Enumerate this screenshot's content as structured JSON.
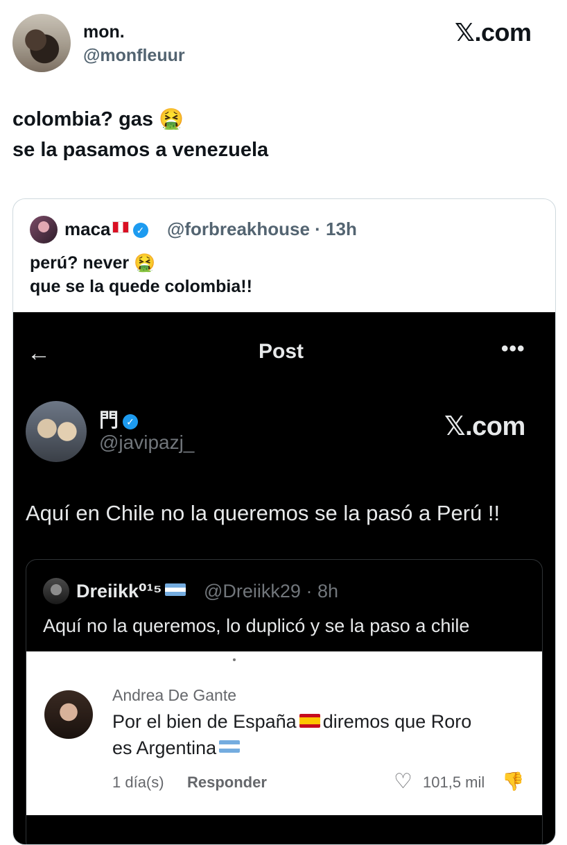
{
  "tweet": {
    "author_name": "mon.",
    "author_handle": "@monfleuur",
    "brand": "𝕏.com",
    "text_line1": "colombia? gas 🤮",
    "text_line2": "se la pasamos a venezuela"
  },
  "quote": {
    "author_name": "maca",
    "author_handle_time": "@forbreakhouse · 13h",
    "text_line1": "perú? never 🤮",
    "text_line2": "que se la quede colombia!!"
  },
  "embedded_post": {
    "header_title": "Post",
    "back_icon": "←",
    "more_icon": "•••",
    "author_name": "門",
    "author_handle": "@javipazj_",
    "brand": "𝕏.com",
    "text": "Aquí en Chile no la queremos se la pasó a Perú !!",
    "inner_quote": {
      "author_name": "Dreiikk⁰¹⁵",
      "author_handle_time": "@Dreiikk29 · 8h",
      "text": "Aquí no la queremos, lo duplicó y se la paso a chile"
    },
    "comment": {
      "author_name": "Andrea De Gante",
      "text_line1_a": "Por el bien de España",
      "text_line1_b": "diremos que Roro",
      "text_line2": "es Argentina",
      "time": "1 día(s)",
      "reply_label": "Responder",
      "heart_icon": "♡",
      "likes": "101,5 mil",
      "dislike_icon": "👎"
    }
  }
}
